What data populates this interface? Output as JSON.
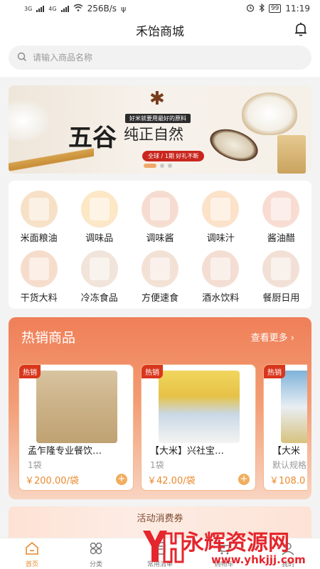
{
  "status_bar": {
    "network_left": "3G",
    "network_right": "4G",
    "speed": "256B/s",
    "battery": "99",
    "time": "11:19"
  },
  "header": {
    "title": "禾饴商城",
    "bell_icon": "bell-icon"
  },
  "search": {
    "placeholder": "请输入商品名称",
    "icon": "search-icon"
  },
  "banner": {
    "headline_big": "五谷",
    "headline": "纯正自然",
    "tagline": "好米就要用最好的原料",
    "pill": "全球 / 1期 好礼不断",
    "dot_count": 3,
    "active_dot": 0
  },
  "categories": [
    {
      "label": "米面粮油",
      "color": "#f7e1c6"
    },
    {
      "label": "调味品",
      "color": "#fde7c5"
    },
    {
      "label": "调味酱",
      "color": "#f6dcd0"
    },
    {
      "label": "调味汁",
      "color": "#fce2c9"
    },
    {
      "label": "酱油醋",
      "color": "#f8dcd2"
    },
    {
      "label": "干货大料",
      "color": "#f6dccb"
    },
    {
      "label": "冷冻食品",
      "color": "#f1e4da"
    },
    {
      "label": "方便速食",
      "color": "#f3e1d5"
    },
    {
      "label": "酒水饮料",
      "color": "#f4ddd2"
    },
    {
      "label": "餐厨日用",
      "color": "#f2e0d6"
    }
  ],
  "hot": {
    "title": "热销商品",
    "more": "查看更多 ›",
    "products": [
      {
        "badge": "热销",
        "name": "孟乍隆专业餐饮…",
        "unit": "1袋",
        "price": "￥200.00/袋",
        "add": "+"
      },
      {
        "badge": "热销",
        "name": "【大米】兴社宝…",
        "unit": "1袋",
        "price": "￥42.00/袋",
        "add": "+"
      },
      {
        "badge": "热销",
        "name": "【大米",
        "unit": "默认规格",
        "price": "￥108.0",
        "add": "+"
      }
    ]
  },
  "coupon": {
    "title": "活动消费券"
  },
  "tabs": [
    {
      "label": "首页",
      "icon": "home-icon",
      "active": true
    },
    {
      "label": "分类",
      "icon": "category-icon",
      "active": false
    },
    {
      "label": "常用清单",
      "icon": "list-icon",
      "active": false
    },
    {
      "label": "购物车",
      "icon": "cart-icon",
      "active": false
    },
    {
      "label": "我的",
      "icon": "user-icon",
      "active": false
    }
  ],
  "watermark": {
    "brand": "永辉资源网",
    "url": "www.yhkjjj.com"
  },
  "colors": {
    "accent": "#e98a2f",
    "hot_gradient_top": "#ef7f58",
    "badge": "#d9361d"
  }
}
